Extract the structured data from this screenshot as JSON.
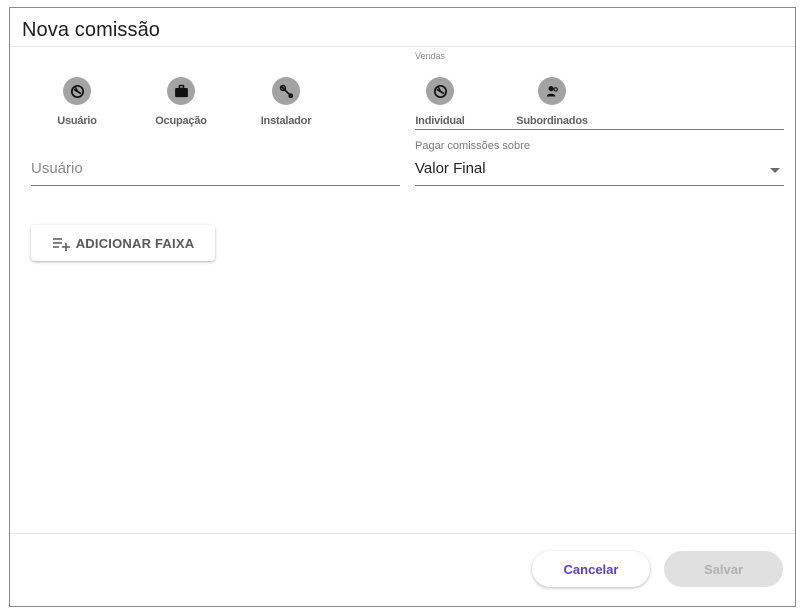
{
  "dialog": {
    "title": "Nova comissão"
  },
  "type_options": [
    {
      "label": "Usuário",
      "icon": "user-history-icon"
    },
    {
      "label": "Ocupação",
      "icon": "briefcase-icon"
    },
    {
      "label": "Instalador",
      "icon": "wrench-icon"
    }
  ],
  "vendas": {
    "label": "Vendas",
    "options": [
      {
        "label": "Individual",
        "icon": "user-history-icon"
      },
      {
        "label": "Subordinados",
        "icon": "account-group-icon"
      }
    ]
  },
  "user_field": {
    "placeholder": "Usuário",
    "value": ""
  },
  "pay_field": {
    "label": "Pagar comissões sobre",
    "value": "Valor Final"
  },
  "add_button": {
    "label": "ADICIONAR FAIXA",
    "icon": "playlist-add-icon"
  },
  "footer": {
    "cancel_label": "Cancelar",
    "save_label": "Salvar"
  },
  "colors": {
    "accent": "#5c3fc9",
    "icon_bg": "#a3a3a3",
    "disabled_bg": "#e0e0e0"
  }
}
